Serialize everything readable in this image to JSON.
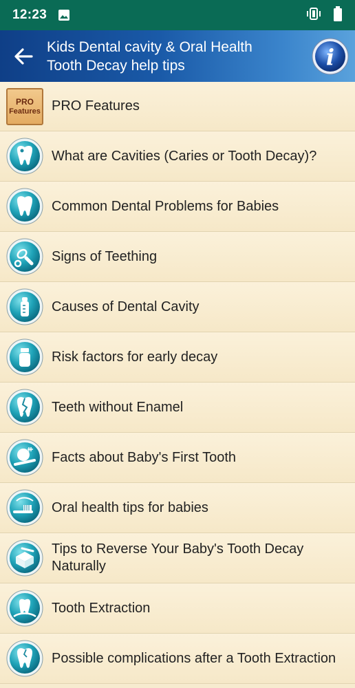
{
  "status_bar": {
    "time": "12:23"
  },
  "app_bar": {
    "title": "Kids Dental cavity & Oral Health\nTooth Decay  help tips"
  },
  "pro_badge": {
    "line1": "PRO",
    "line2": "Features"
  },
  "items": [
    {
      "label": "PRO Features",
      "icon": "pro-features-badge"
    },
    {
      "label": "What are Cavities (Caries or Tooth Decay)?",
      "icon": "tooth-cavity-icon"
    },
    {
      "label": "Common Dental Problems for Babies",
      "icon": "tooth-icon"
    },
    {
      "label": "Signs of Teething",
      "icon": "pacifier-icon"
    },
    {
      "label": "Causes of Dental Cavity",
      "icon": "baby-bottle-icon"
    },
    {
      "label": "Risk factors for early decay",
      "icon": "jar-icon"
    },
    {
      "label": "Teeth without Enamel",
      "icon": "broken-tooth-icon"
    },
    {
      "label": "Facts about Baby's First Tooth",
      "icon": "baby-toothbrush-icon"
    },
    {
      "label": "Oral health tips for babies",
      "icon": "toothbrush-icon"
    },
    {
      "label": "Tips to Reverse Your Baby's Tooth Decay Naturally",
      "icon": "box-icon"
    },
    {
      "label": "Tooth Extraction",
      "icon": "tooth-extraction-icon"
    },
    {
      "label": "Possible complications after a Tooth Extraction",
      "icon": "cracked-tooth-icon"
    }
  ],
  "colors": {
    "status_bar": "#0a6b55",
    "app_bar_dark": "#0f3f87",
    "app_bar_light": "#5aa2dc",
    "list_background": "#f7ebcf",
    "icon_teal": "#1fa3b8"
  }
}
